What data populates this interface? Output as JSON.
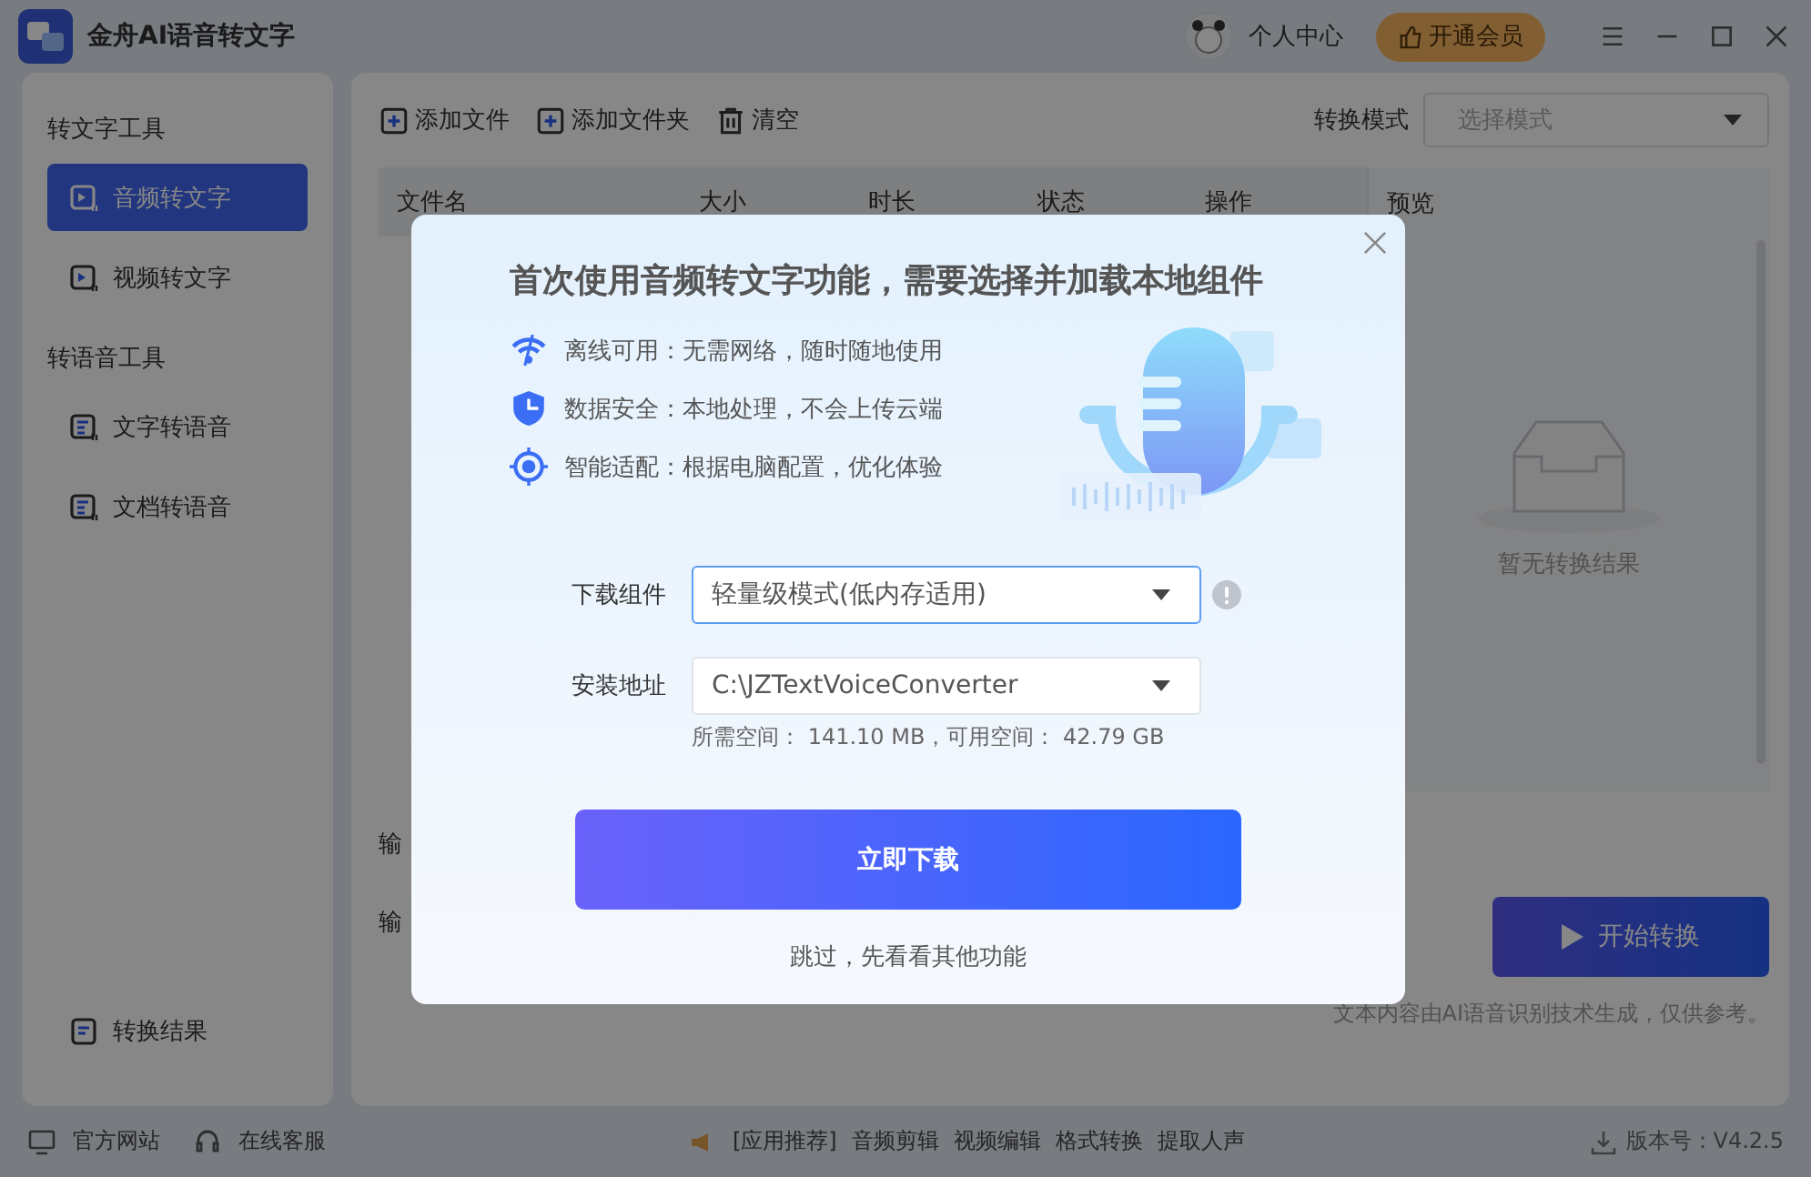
{
  "app": {
    "title": "金舟AI语音转文字"
  },
  "header": {
    "user_label": "个人中心",
    "vip_button": "开通会员"
  },
  "sidebar": {
    "sections": [
      {
        "title": "转文字工具",
        "items": [
          {
            "label": "音频转文字",
            "selected": true
          },
          {
            "label": "视频转文字",
            "selected": false
          }
        ]
      },
      {
        "title": "转语音工具",
        "items": [
          {
            "label": "文字转语音",
            "selected": false
          },
          {
            "label": "文档转语音",
            "selected": false
          }
        ]
      }
    ],
    "bottom_item": {
      "label": "转换结果"
    }
  },
  "toolbar": {
    "buttons": [
      "添加文件",
      "添加文件夹",
      "清空"
    ],
    "mode_label": "转换模式",
    "mode_placeholder": "选择模式"
  },
  "table": {
    "columns": [
      "文件名",
      "大小",
      "时长",
      "状态",
      "操作"
    ]
  },
  "preview": {
    "title": "预览",
    "empty_text": "暂无转换结果"
  },
  "output_labels": [
    "输",
    "输"
  ],
  "start_button": "开始转换",
  "disclaimer": "文本内容由AI语音识别技术生成，仅供参考。",
  "footer": {
    "left": [
      "官方网站",
      "在线客服"
    ],
    "recommend_label": "[应用推荐]",
    "links": [
      "音频剪辑",
      "视频编辑",
      "格式转换",
      "提取人声"
    ],
    "version": "版本号：V4.2.5"
  },
  "dialog": {
    "title": "首次使用音频转文字功能，需要选择并加载本地组件",
    "features": [
      "离线可用：无需网络，随时随地使用",
      "数据安全：本地处理，不会上传云端",
      "智能适配：根据电脑配置，优化体验"
    ],
    "fields": [
      {
        "label": "下载组件",
        "value": "轻量级模式(低内存适用)",
        "focused": true
      },
      {
        "label": "安装地址",
        "value": "C:\\JZTextVoiceConverter",
        "focused": false
      }
    ],
    "space_note": "所需空间： 141.10 MB，可用空间： 42.79 GB",
    "primary_button": "立即下载",
    "skip_link": "跳过，先看看其他功能"
  }
}
